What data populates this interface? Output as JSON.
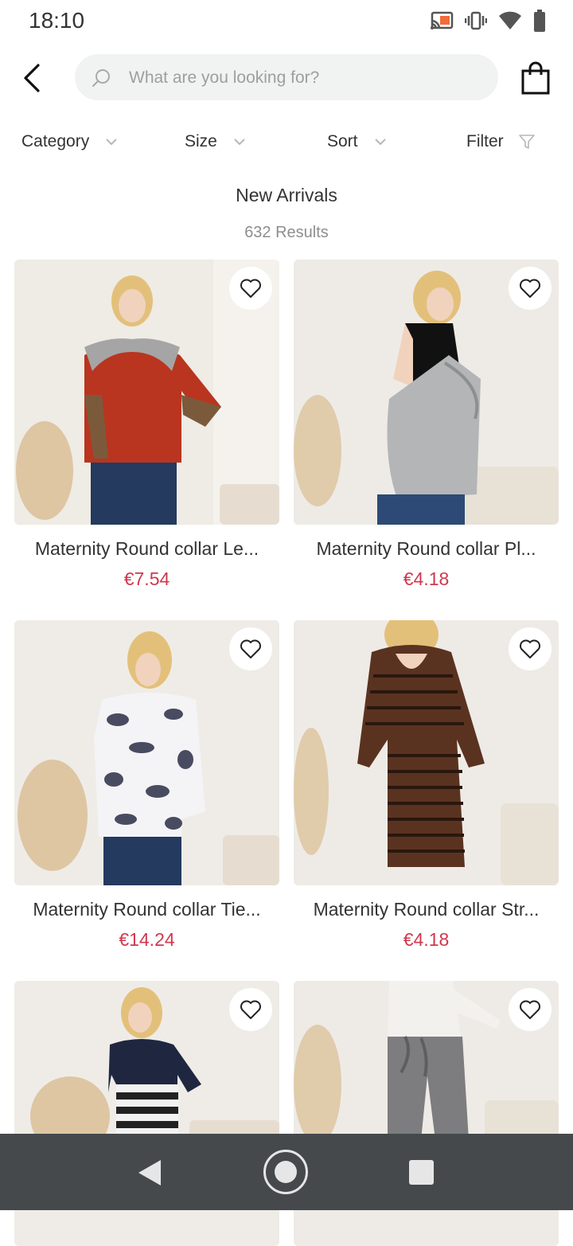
{
  "status_bar": {
    "time": "18:10",
    "icons": [
      "cast-icon",
      "vibrate-icon",
      "wifi-icon",
      "battery-icon"
    ]
  },
  "header": {
    "back_icon": "chevron-left-icon",
    "search": {
      "placeholder": "What are you looking for?",
      "value": "",
      "icon": "search-icon"
    },
    "bag_icon": "shopping-bag-icon"
  },
  "filters": {
    "category": "Category",
    "size": "Size",
    "sort": "Sort",
    "filter": "Filter"
  },
  "listing": {
    "title": "New Arrivals",
    "results": "632 Results"
  },
  "products": [
    {
      "name": "Maternity Round collar Le...",
      "price": "€7.54"
    },
    {
      "name": "Maternity Round collar Pl...",
      "price": "€4.18"
    },
    {
      "name": "Maternity Round collar Tie...",
      "price": "€14.24"
    },
    {
      "name": "Maternity Round collar Str...",
      "price": "€4.18"
    },
    {
      "name": "",
      "price": ""
    },
    {
      "name": "",
      "price": ""
    }
  ],
  "colors": {
    "price": "#d0384f",
    "navbar": "#45494c",
    "search_bg": "#f1f2f2"
  },
  "system_nav": [
    "back-triangle-icon",
    "home-circle-icon",
    "recents-square-icon"
  ]
}
